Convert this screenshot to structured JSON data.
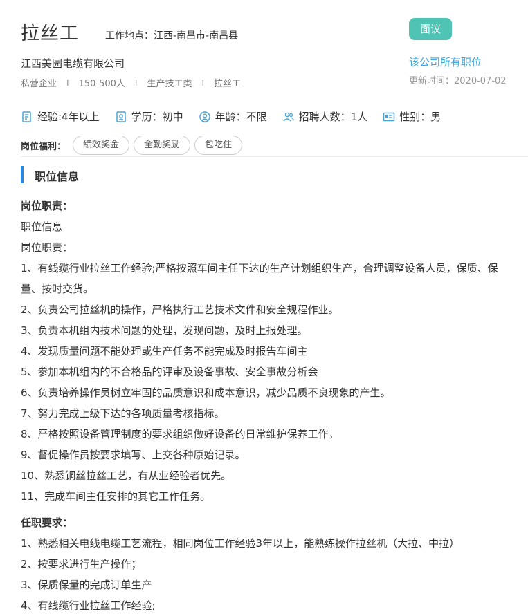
{
  "job": {
    "title": "拉丝工",
    "location": "工作地点：江西-南昌市-南昌县",
    "salary": "面议",
    "company": "江西美园电缆有限公司",
    "all_jobs_link": "该公司所有职位",
    "update_time": "更新时间：2020-07-02",
    "tags": [
      "私营企业",
      "150-500人",
      "生产技工类",
      "拉丝工"
    ],
    "tag_separator": "I"
  },
  "requirements": {
    "experience": "经验:4年以上",
    "education": "学历：初中",
    "age": "年龄：不限",
    "headcount": "招聘人数：1人",
    "gender": "性别：男"
  },
  "benefits": {
    "label": "岗位福利：",
    "items": [
      "绩效奖金",
      "全勤奖励",
      "包吃住"
    ]
  },
  "section": {
    "title": "职位信息"
  },
  "description": {
    "duties_heading": "岗位职责：",
    "intro_lines": [
      "职位信息",
      "岗位职责："
    ],
    "duties": [
      "1、有线缆行业拉丝工作经验;严格按照车间主任下达的生产计划组织生产，合理调整设备人员，保质、保",
      "量、按时交货。",
      "2、负责公司拉丝机的操作，严格执行工艺技术文件和安全规程作业。",
      "3、负责本机组内技术问题的处理，发现问题，及时上报处理。",
      "4、发现质量问题不能处理或生产任务不能完成及时报告车间主",
      "5、参加本机组内的不合格品的评审及设备事故、安全事故分析会",
      "6、负责培养操作员树立牢固的品质意识和成本意识，减少品质不良现象的产生。",
      "7、努力完成上级下达的各项质量考核指标。",
      "8、严格按照设备管理制度的要求组织做好设备的日常维护保养工作。",
      "9、督促操作员按要求填写、上交各种原始记录。",
      "10、熟悉铜丝拉丝工艺，有从业经验者优先。",
      "11、完成车间主任安排的其它工作任务。"
    ],
    "req_heading": "任职要求：",
    "reqs": [
      "1、熟悉相关电线电缆工艺流程，相同岗位工作经验3年以上，能熟练操作拉丝机（大拉、中拉）",
      "2、按要求进行生产操作；",
      "3、保质保量的完成订单生产",
      "4、有线缆行业拉丝工作经验;"
    ]
  },
  "colors": {
    "accent_teal": "#4fc3b4",
    "link_blue": "#3ba9e0",
    "section_bar": "#2e86de",
    "icon_blue": "#4aa3d8"
  },
  "icons": {
    "experience": "document-icon",
    "education": "diploma-icon",
    "age": "person-circle-icon",
    "headcount": "group-icon",
    "gender": "id-card-icon"
  }
}
